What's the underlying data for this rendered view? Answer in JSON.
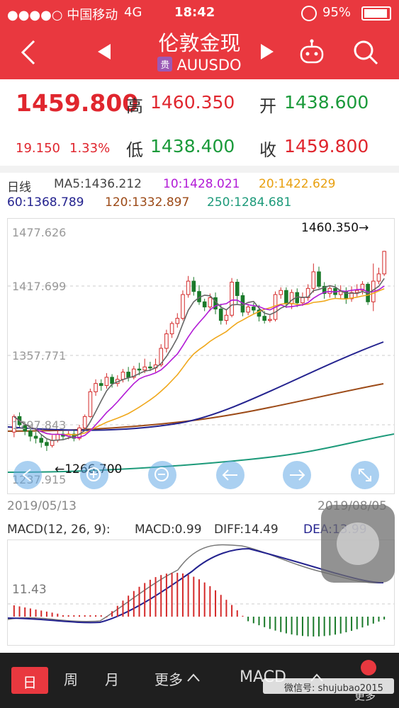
{
  "status": {
    "carrier": "●●●●○ 中国移动",
    "network": "4G",
    "time": "18:42",
    "battery": "95%"
  },
  "nav": {
    "back_icon": "chevron-left-icon",
    "title": "伦敦金现",
    "badge": "贵",
    "symbol": "AUUSDO",
    "prev_icon": "triangle-left-icon",
    "next_icon": "triangle-right-icon",
    "robot_icon": "robot-icon",
    "search_icon": "search-icon"
  },
  "quote": {
    "price": "1459.800",
    "change": "19.150",
    "change_pct": "1.33%",
    "high_label": "高",
    "high": "1460.350",
    "open_label": "开",
    "open": "1438.600",
    "low_label": "低",
    "low": "1438.400",
    "close_label": "收",
    "close": "1459.800"
  },
  "ma": {
    "period": "日线",
    "ma5": "MA5:1436.212",
    "ma10": "10:1428.021",
    "ma20": "20:1422.629",
    "ma60": "60:1368.789",
    "ma120": "120:1332.897",
    "ma250": "250:1284.681"
  },
  "colors": {
    "ma5": "#666666",
    "ma10": "#b21ad6",
    "ma20": "#f0a81c",
    "ma60": "#24238f",
    "ma120": "#9c4a17",
    "ma250": "#1d9a7a",
    "up": "#d42a2a",
    "down": "#1a7a2a"
  },
  "kline": {
    "y_labels": [
      "1477.626",
      "1417.699",
      "1357.771",
      "1297.843",
      "1237.915"
    ],
    "high_marker": "1460.350→",
    "low_marker": "←1266.700",
    "date_start": "2019/05/13",
    "date_end": "2019/08/05",
    "candles": [
      [
        1285,
        1300,
        1280,
        1302
      ],
      [
        1300,
        1292,
        1290,
        1304
      ],
      [
        1292,
        1286,
        1282,
        1295
      ],
      [
        1286,
        1281,
        1276,
        1290
      ],
      [
        1281,
        1279,
        1274,
        1285
      ],
      [
        1279,
        1275,
        1270,
        1283
      ],
      [
        1275,
        1272,
        1266.7,
        1278
      ],
      [
        1272,
        1277,
        1270,
        1282
      ],
      [
        1277,
        1283,
        1275,
        1287
      ],
      [
        1283,
        1281,
        1278,
        1286
      ],
      [
        1281,
        1283,
        1278,
        1286
      ],
      [
        1283,
        1279,
        1276,
        1287
      ],
      [
        1279,
        1289,
        1277,
        1292
      ],
      [
        1289,
        1300,
        1288,
        1302
      ],
      [
        1300,
        1324,
        1299,
        1327
      ],
      [
        1324,
        1332,
        1320,
        1336
      ],
      [
        1332,
        1330,
        1325,
        1336
      ],
      [
        1330,
        1338,
        1327,
        1342
      ],
      [
        1338,
        1332,
        1328,
        1341
      ],
      [
        1332,
        1336,
        1329,
        1340
      ],
      [
        1336,
        1343,
        1333,
        1346
      ],
      [
        1343,
        1338,
        1334,
        1348
      ],
      [
        1338,
        1346,
        1336,
        1349
      ],
      [
        1346,
        1345,
        1340,
        1352
      ],
      [
        1345,
        1348,
        1342,
        1356
      ],
      [
        1348,
        1347,
        1344,
        1353
      ],
      [
        1347,
        1350,
        1343,
        1356
      ],
      [
        1350,
        1366,
        1348,
        1370
      ],
      [
        1366,
        1380,
        1362,
        1384
      ],
      [
        1380,
        1390,
        1376,
        1392
      ],
      [
        1390,
        1395,
        1386,
        1400
      ],
      [
        1395,
        1418,
        1393,
        1422
      ],
      [
        1418,
        1431,
        1415,
        1436
      ],
      [
        1431,
        1421,
        1417,
        1435
      ],
      [
        1421,
        1411,
        1408,
        1427
      ],
      [
        1411,
        1406,
        1402,
        1414
      ],
      [
        1406,
        1415,
        1402,
        1419
      ],
      [
        1415,
        1404,
        1399,
        1420
      ],
      [
        1404,
        1393,
        1389,
        1409
      ],
      [
        1393,
        1398,
        1389,
        1404
      ],
      [
        1398,
        1430,
        1396,
        1434
      ],
      [
        1430,
        1417,
        1409,
        1433
      ],
      [
        1417,
        1401,
        1397,
        1420
      ],
      [
        1401,
        1406,
        1398,
        1409
      ],
      [
        1406,
        1403,
        1399,
        1410
      ],
      [
        1403,
        1397,
        1392,
        1408
      ],
      [
        1397,
        1393,
        1390,
        1402
      ],
      [
        1393,
        1394,
        1391,
        1398
      ],
      [
        1394,
        1418,
        1392,
        1421
      ],
      [
        1418,
        1422,
        1414,
        1425
      ],
      [
        1422,
        1409,
        1405,
        1425
      ],
      [
        1409,
        1420,
        1404,
        1423
      ],
      [
        1420,
        1410,
        1406,
        1424
      ],
      [
        1410,
        1415,
        1407,
        1420
      ],
      [
        1415,
        1424,
        1412,
        1428
      ],
      [
        1424,
        1440,
        1420,
        1448
      ],
      [
        1440,
        1426,
        1424,
        1445
      ],
      [
        1426,
        1419,
        1414,
        1430
      ],
      [
        1419,
        1424,
        1415,
        1427
      ],
      [
        1424,
        1418,
        1414,
        1428
      ],
      [
        1418,
        1421,
        1414,
        1427
      ],
      [
        1421,
        1414,
        1409,
        1425
      ],
      [
        1414,
        1420,
        1411,
        1426
      ],
      [
        1420,
        1422,
        1416,
        1428
      ],
      [
        1422,
        1428,
        1418,
        1431
      ],
      [
        1428,
        1411,
        1408,
        1430
      ],
      [
        1411,
        1431,
        1402,
        1448
      ],
      [
        1431,
        1438,
        1428,
        1444
      ],
      [
        1438,
        1459.8,
        1436,
        1460.35
      ]
    ]
  },
  "macd": {
    "params": "MACD(12, 26, 9):",
    "macd": "MACD:0.99",
    "diff": "DIFF:14.49",
    "dea": "DEA:13.99",
    "y_label": "11.43"
  },
  "bottom": {
    "tab_day": "日",
    "tab_week": "周",
    "tab_month": "月",
    "more": "更多",
    "chevron_icon": "chevron-up-icon",
    "indicator": "MACD",
    "watermark": "微信号: shujubao2015",
    "more2": "更多"
  }
}
